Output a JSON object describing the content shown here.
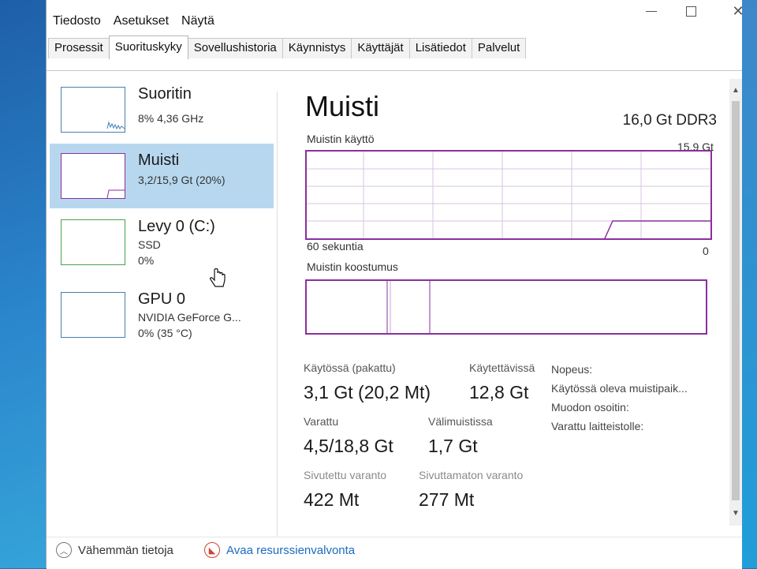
{
  "menu": [
    "Tiedosto",
    "Asetukset",
    "Näytä"
  ],
  "tabs": [
    {
      "label": "Prosessit",
      "active": false
    },
    {
      "label": "Suorituskyky",
      "active": true
    },
    {
      "label": "Sovellushistoria",
      "active": false
    },
    {
      "label": "Käynnistys",
      "active": false
    },
    {
      "label": "Käyttäjät",
      "active": false
    },
    {
      "label": "Lisätiedot",
      "active": false
    },
    {
      "label": "Palvelut",
      "active": false
    }
  ],
  "resources": [
    {
      "title": "Suoritin",
      "line1": "8% 4,36 GHz",
      "line2": ""
    },
    {
      "title": "Muisti",
      "line1": "3,2/15,9 Gt (20%)",
      "line2": ""
    },
    {
      "title": "Levy 0 (C:)",
      "line1": "SSD",
      "line2": "0%"
    },
    {
      "title": "GPU 0",
      "line1": "NVIDIA GeForce G...",
      "line2": "0% (35 °C)"
    }
  ],
  "main": {
    "title": "Muisti",
    "spec": "16,0 Gt DDR3",
    "usage_label": "Muistin käyttö",
    "usage_max": "15,9 Gt",
    "time_label": "60 sekuntia",
    "min_label": "0",
    "composition_label": "Muistin koostumus",
    "usage_level": 0.2
  },
  "stats": {
    "in_use_label": "Käytössä (pakattu)",
    "in_use_value": "3,1 Gt (20,2 Mt)",
    "available_label": "Käytettävissä",
    "available_value": "12,8 Gt",
    "committed_label": "Varattu",
    "committed_value": "4,5/18,8 Gt",
    "cached_label": "Välimuistissa",
    "cached_value": "1,7 Gt",
    "paged_label": "Sivutettu varanto",
    "paged_value": "422 Mt",
    "nonpaged_label": "Sivuttamaton varanto",
    "nonpaged_value": "277 Mt"
  },
  "properties": [
    "Nopeus:",
    "Käytössä oleva muistipaik...",
    "Muodon osoitin:",
    "Varattu laitteistolle:"
  ],
  "bottom": {
    "fewer_details": "Vähemmän tietoja",
    "open_resmon": "Avaa resurssienvalvonta"
  },
  "colors": {
    "memory_accent": "#8b2ea0",
    "cpu_accent": "#4a7fb0",
    "disk_accent": "#4aa24a",
    "selected_bg": "#b7d7ef"
  }
}
